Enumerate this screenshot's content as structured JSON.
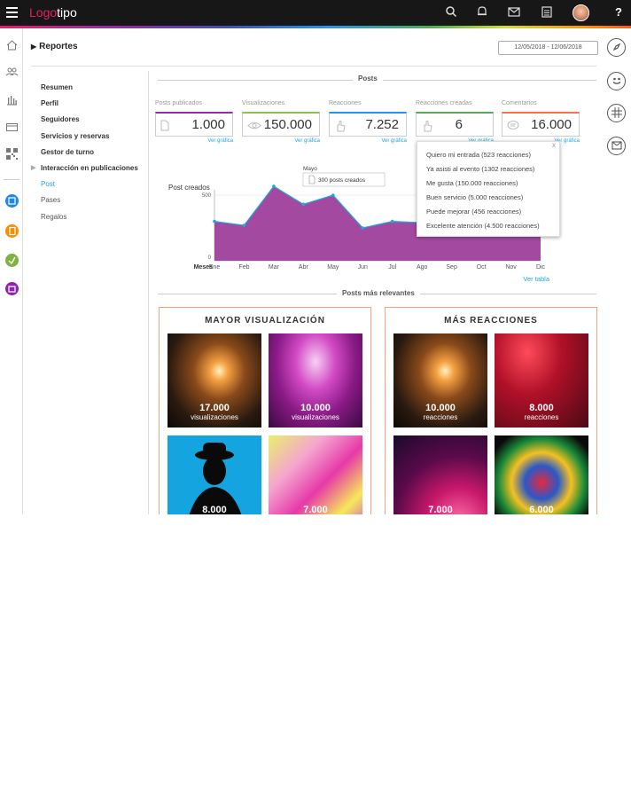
{
  "header": {
    "logo_a": "Logo",
    "logo_b": "tipo",
    "help": "?"
  },
  "breadcrumb": {
    "title": "Reportes"
  },
  "daterange": "12/05/2018 - 12/06/2018",
  "nav": [
    {
      "label": "Resumen"
    },
    {
      "label": "Perfil"
    },
    {
      "label": "Seguidores"
    },
    {
      "label": "Servicios y reservas"
    },
    {
      "label": "Gestor de turno"
    },
    {
      "label": "Interacción en publicaciones"
    },
    {
      "label": "Post"
    },
    {
      "label": "Pases"
    },
    {
      "label": "Regalos"
    }
  ],
  "posts_section": "Posts",
  "stats": [
    {
      "label": "Posts publicados",
      "value": "1.000",
      "link": "Ver gráfica",
      "color": "#9c27b0"
    },
    {
      "label": "Visualizaciones",
      "value": "150.000",
      "link": "Ver gráfica",
      "color": "#8bc34a"
    },
    {
      "label": "Reacciones",
      "value": "7.252",
      "link": "Ver gráfica",
      "color": "#2196f3"
    },
    {
      "label": "Reacciones creadas",
      "value": "6",
      "link": "Ver gráfica",
      "color": "#4caf50"
    },
    {
      "label": "Comentarios",
      "value": "16.000",
      "link": "Ver gráfica",
      "color": "#ff7043"
    }
  ],
  "reactions_popup": {
    "close": "x",
    "items": [
      "Quiero mi entrada (523 reacciones)",
      "Ya asisti al evento (1302 reacciones)",
      "Me gusta (150.000 reacciones)",
      "Buen servicio (5.000 reacciones)",
      "Puede mejorar (456 reacciones)",
      "Excelente atención (4.500 reacciones)"
    ]
  },
  "chart_data": {
    "type": "area",
    "categories": [
      "Ene",
      "Feb",
      "Mar",
      "Abr",
      "May",
      "Jun",
      "Jul",
      "Ago",
      "Sep",
      "Oct",
      "Nov",
      "Dic"
    ],
    "values": [
      300,
      270,
      640,
      430,
      500,
      250,
      300,
      290,
      350,
      330,
      330,
      380
    ],
    "ylabel": "Post creados",
    "xlabel": "Meses",
    "yticks": [
      "0",
      "500"
    ],
    "ylim": [
      0,
      700
    ],
    "color": "#9c3a98",
    "tooltip": {
      "month": "Mayo",
      "text": "300 posts creados"
    },
    "table_link": "Ver tabla"
  },
  "relevant_section": "Posts más relevantes",
  "cards": [
    {
      "title": "MAYOR VISUALIZACIÓN",
      "color": "#f4a27c",
      "tiles": [
        {
          "num": "17.000",
          "cap": "visualizaciones"
        },
        {
          "num": "10.000",
          "cap": "visualizaciones"
        },
        {
          "num": "8.000",
          "cap": ""
        },
        {
          "num": "7.000",
          "cap": ""
        }
      ]
    },
    {
      "title": "MÁS REACCIONES",
      "color": "#f4a27c",
      "tiles": [
        {
          "num": "10.000",
          "cap": "reacciones"
        },
        {
          "num": "8.000",
          "cap": "reacciones"
        },
        {
          "num": "7.000",
          "cap": ""
        },
        {
          "num": "6.000",
          "cap": ""
        }
      ]
    }
  ]
}
